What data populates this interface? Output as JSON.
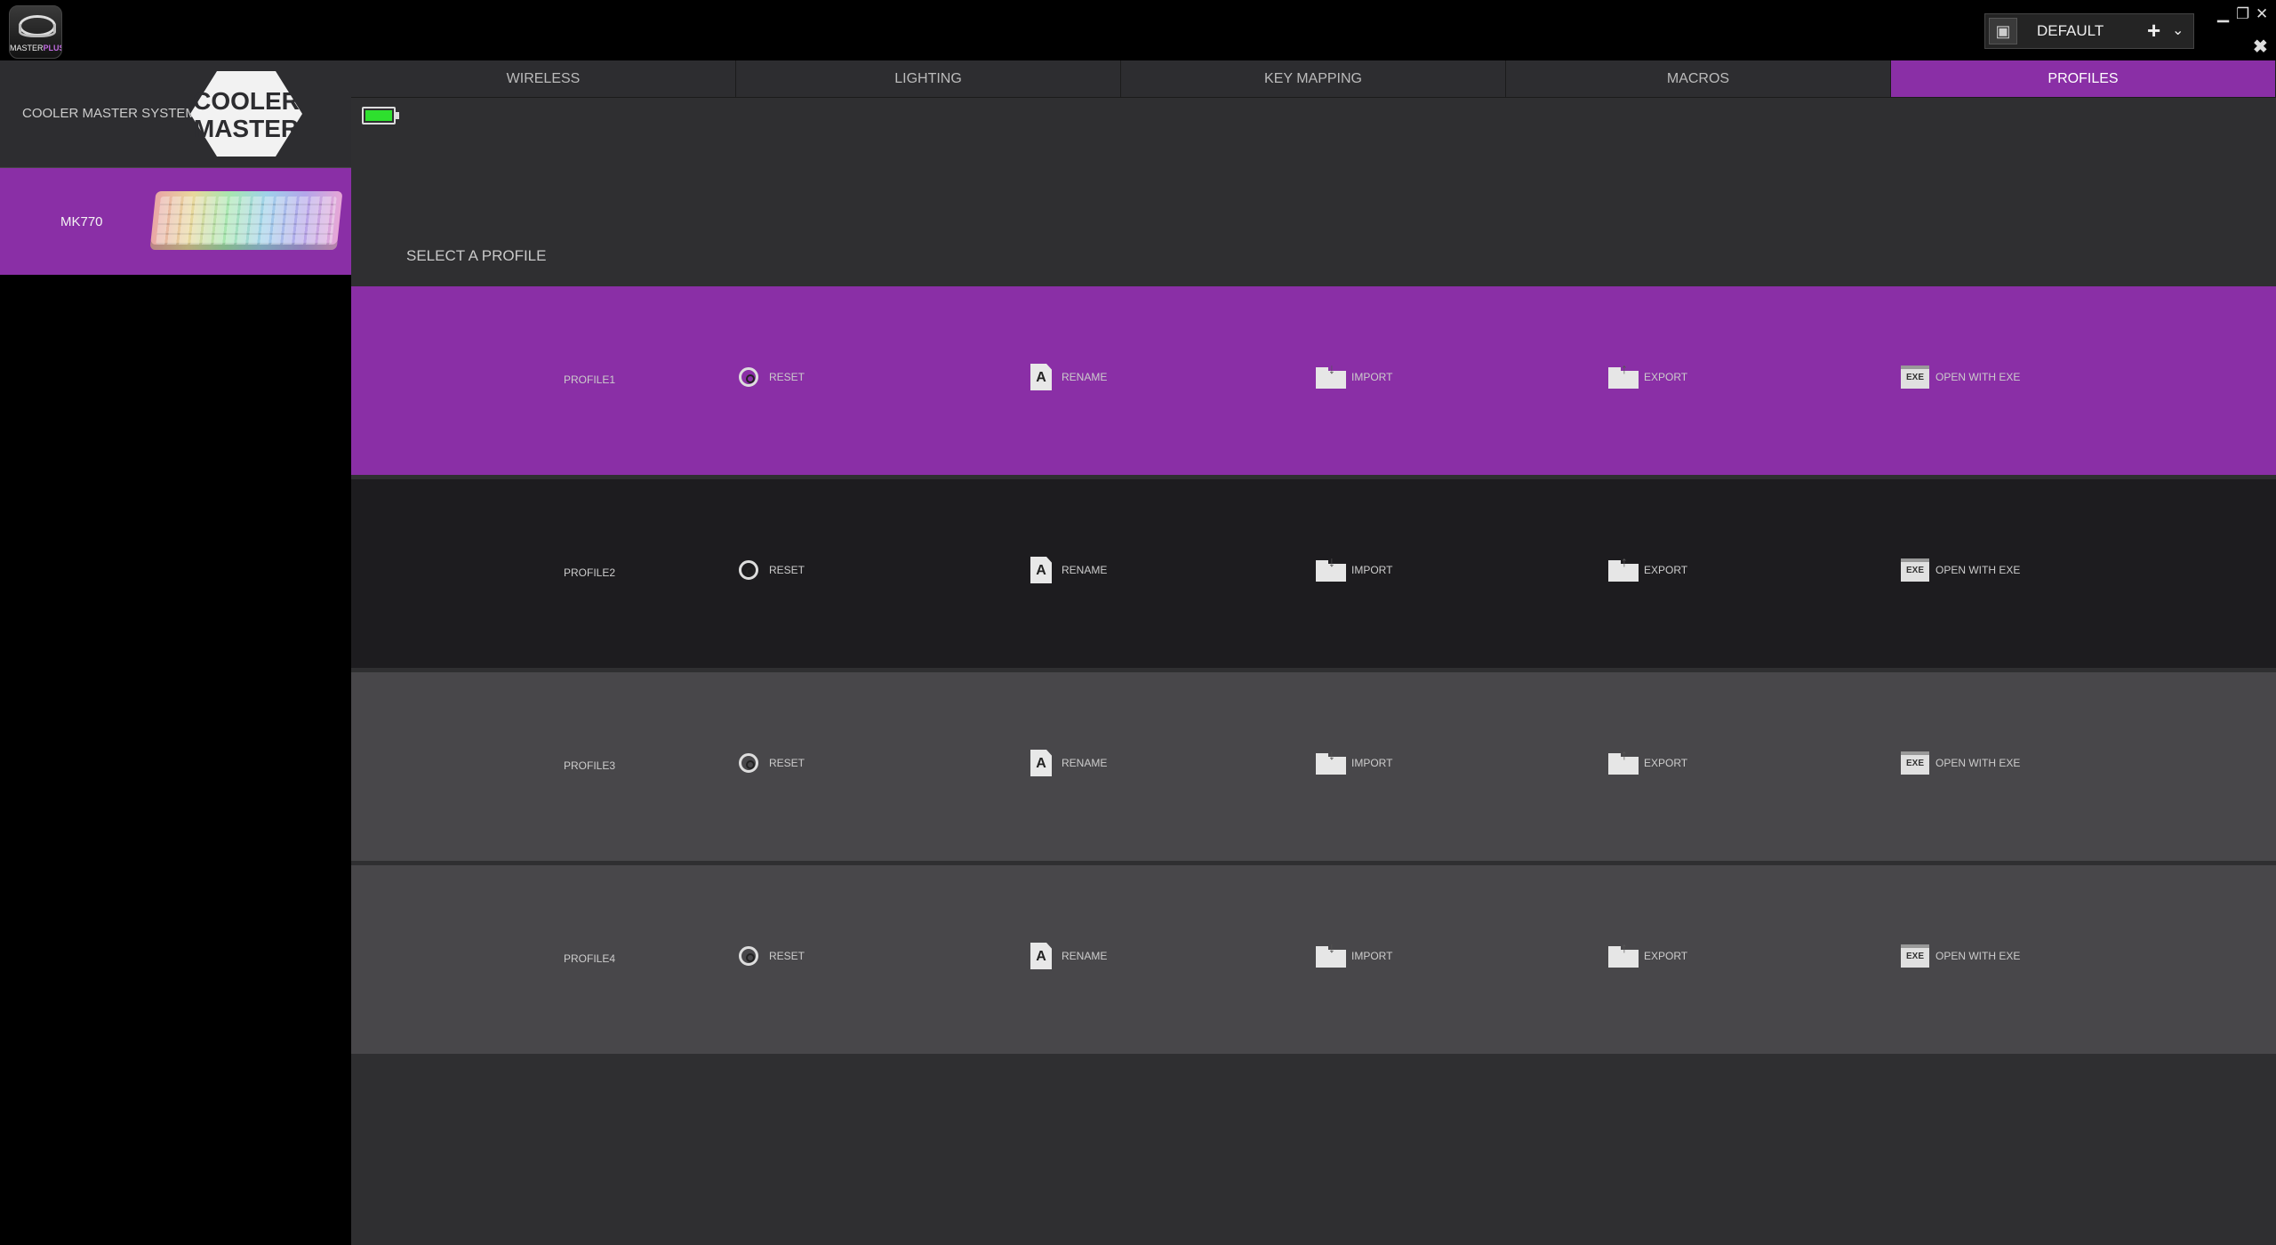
{
  "app": {
    "logo_text_a": "MASTER",
    "logo_text_b": "PLUS+"
  },
  "header": {
    "profile_selector": "DEFAULT",
    "add_icon": "plus-icon",
    "dropdown_icon": "chevron-down-icon"
  },
  "window": {
    "minimize": "▁",
    "restore": "❐",
    "close": "✕",
    "pin": "✖"
  },
  "sidebar": {
    "cooler_master": {
      "label": "COOLER MASTER SYSTEM",
      "logo_line1": "COOLER",
      "logo_line2": "MASTER"
    },
    "device": {
      "label": "MK770"
    }
  },
  "tabs": [
    "WIRELESS",
    "LIGHTING",
    "KEY MAPPING",
    "MACROS",
    "PROFILES"
  ],
  "active_tab": "PROFILES",
  "battery": {
    "level": 1.0
  },
  "main": {
    "select_label": "SELECT A PROFILE"
  },
  "actions": {
    "reset": "RESET",
    "rename": "RENAME",
    "import": "IMPORT",
    "export": "EXPORT",
    "open_exe": "OPEN WITH EXE",
    "exe_icon_text": "EXE",
    "rename_icon_text": "A"
  },
  "profiles": [
    {
      "name": "PROFILE1",
      "selected": true,
      "bg": "#8a2fa6"
    },
    {
      "name": "PROFILE2",
      "selected": false,
      "bg": "#1d1c1f"
    },
    {
      "name": "PROFILE3",
      "selected": false,
      "bg": "#48474a"
    },
    {
      "name": "PROFILE4",
      "selected": false,
      "bg": "#48474a"
    }
  ],
  "colors": {
    "accent": "#8a2fa6",
    "battery": "#2ee02e"
  }
}
